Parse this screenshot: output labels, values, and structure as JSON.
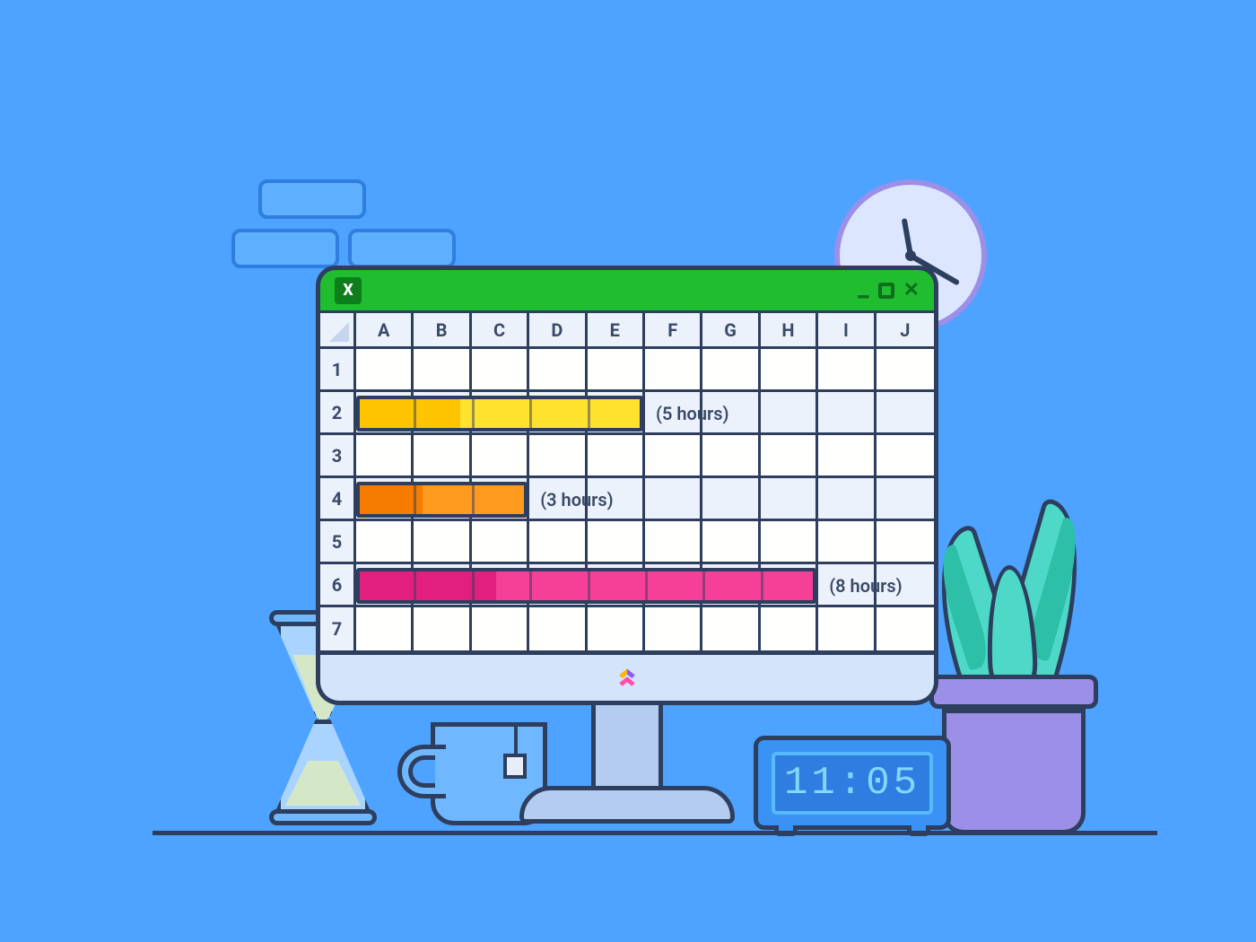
{
  "spreadsheet": {
    "columns": [
      "A",
      "B",
      "C",
      "D",
      "E",
      "F",
      "G",
      "H",
      "I",
      "J"
    ],
    "rows": [
      "1",
      "2",
      "3",
      "4",
      "5",
      "6",
      "7"
    ],
    "bars": [
      {
        "row": 2,
        "start_col": "A",
        "span": 5,
        "label": "(5 hours)",
        "color": "yellow"
      },
      {
        "row": 4,
        "start_col": "A",
        "span": 3,
        "label": "(3 hours)",
        "color": "orange"
      },
      {
        "row": 6,
        "start_col": "A",
        "span": 8,
        "label": "(8 hours)",
        "color": "pink"
      }
    ]
  },
  "titlebar": {
    "app_icon_letter": "X",
    "minimize": "_",
    "maximize": "▢",
    "close": "✕"
  },
  "digital_clock": {
    "time": "11:05"
  }
}
